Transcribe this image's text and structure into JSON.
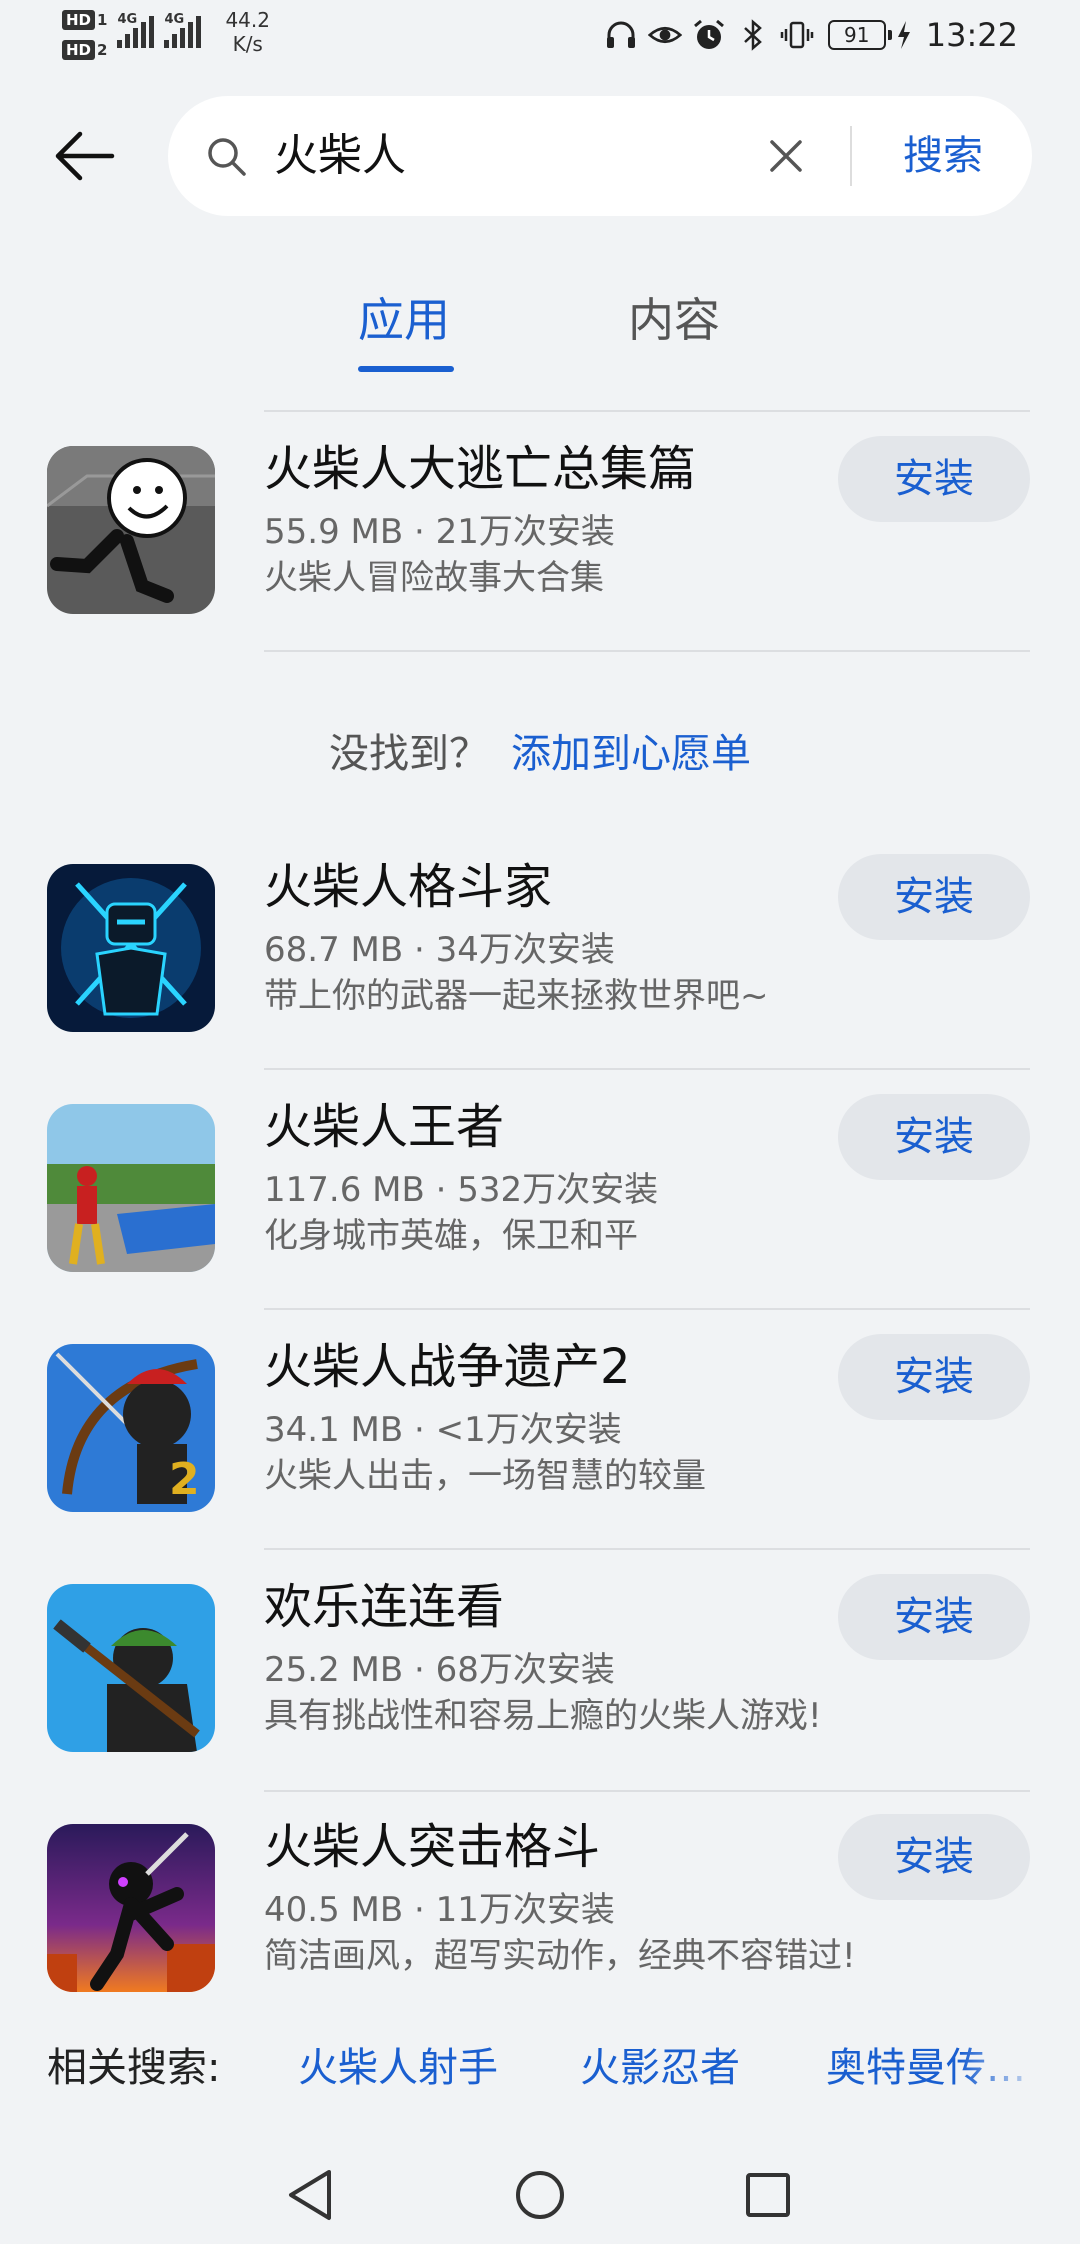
{
  "status_bar": {
    "sim1": "HD",
    "sim1_num": "1",
    "sim2": "HD",
    "sim2_num": "2",
    "net1": "4G",
    "net2": "4G",
    "net_speed_value": "44.2",
    "net_speed_unit": "K/s",
    "battery": "91",
    "time": "13:22",
    "icons": [
      "headphones-icon",
      "eye-icon",
      "alarm-icon",
      "bluetooth-icon",
      "vibrate-icon",
      "charging-icon"
    ]
  },
  "search": {
    "query": "火柴人",
    "button_label": "搜索"
  },
  "tabs": [
    {
      "label": "应用",
      "active": true
    },
    {
      "label": "内容",
      "active": false
    }
  ],
  "colors": {
    "accent": "#1a5fd0",
    "background": "#f1f3f5",
    "button_bg": "#e3e6ea"
  },
  "wishlist": {
    "question": "没找到？",
    "link": "添加到心愿单"
  },
  "apps": [
    {
      "name": "火柴人大逃亡总集篇",
      "meta": "55.9 MB · 21万次安装",
      "desc": "火柴人冒险故事大合集",
      "button": "安装"
    },
    {
      "name": "火柴人格斗家",
      "meta": "68.7 MB · 34万次安装",
      "desc": "带上你的武器一起来拯救世界吧~",
      "button": "安装"
    },
    {
      "name": "火柴人王者",
      "meta": "117.6 MB · 532万次安装",
      "desc": "化身城市英雄，保卫和平",
      "button": "安装"
    },
    {
      "name": "火柴人战争遗产2",
      "meta": "34.1 MB · <1万次安装",
      "desc": "火柴人出击，一场智慧的较量",
      "button": "安装"
    },
    {
      "name": "欢乐连连看",
      "meta": "25.2 MB · 68万次安装",
      "desc": "具有挑战性和容易上瘾的火柴人游戏!",
      "button": "安装"
    },
    {
      "name": "火柴人突击格斗",
      "meta": "40.5 MB · 11万次安装",
      "desc": "简洁画风，超写实动作，经典不容错过!",
      "button": "安装"
    }
  ],
  "related": {
    "label": "相关搜索:",
    "items": [
      "火柴人射手",
      "火影忍者",
      "奥特曼传…"
    ]
  },
  "navbar": {
    "icons": [
      "back-triangle-icon",
      "home-circle-icon",
      "recents-square-icon"
    ]
  }
}
